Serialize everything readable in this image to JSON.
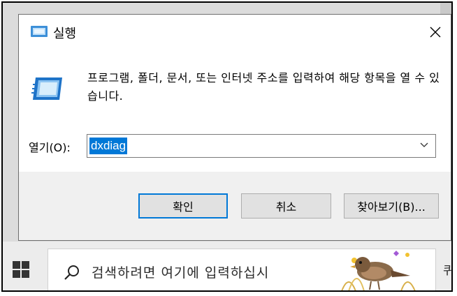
{
  "dialog": {
    "title": "실행",
    "description": "프로그램, 폴더, 문서, 또는 인터넷 주소를 입력하여 해당 항목을 열 수 있습니다.",
    "open_label": "열기(O):",
    "open_value": "dxdiag",
    "buttons": {
      "ok": "확인",
      "cancel": "취소",
      "browse": "찾아보기(B)..."
    }
  },
  "taskbar": {
    "search_placeholder": "검색하려면 여기에 입력하십시",
    "extra_glyph": "퀴"
  },
  "colors": {
    "accent": "#0078d7",
    "button_bg": "#e1e1e1"
  },
  "icons": [
    "run-icon",
    "close-icon",
    "chevron-down-icon",
    "windows-icon",
    "search-icon"
  ]
}
